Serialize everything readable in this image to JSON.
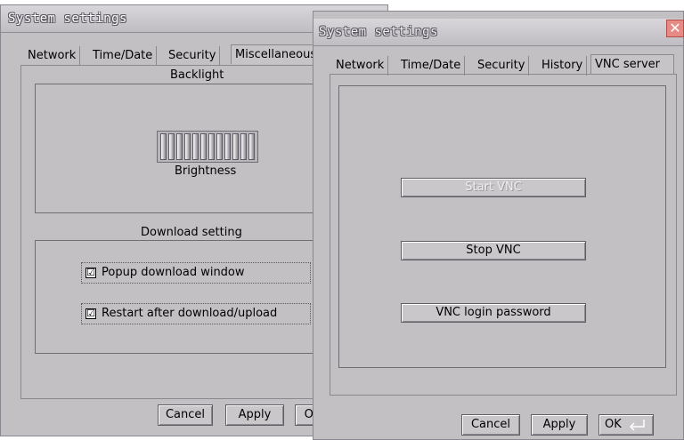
{
  "back_window": {
    "title": "System settings",
    "tabs": [
      "Network",
      "Time/Date",
      "Security",
      "Miscellaneous"
    ],
    "backlight": {
      "heading": "Backlight",
      "slider_label": "Brightness",
      "slider_segments": 12
    },
    "download": {
      "heading": "Download setting",
      "options": [
        {
          "label": "Popup download window",
          "checked": true,
          "mark": "☑"
        },
        {
          "label": "Restart after download/upload",
          "checked": true,
          "mark": "☑"
        }
      ]
    },
    "buttons": {
      "cancel": "Cancel",
      "apply": "Apply",
      "ok": "OK"
    }
  },
  "front_window": {
    "title": "System settings",
    "close_glyph": "✕",
    "tabs": [
      "Network",
      "Time/Date",
      "Security",
      "History",
      "VNC server"
    ],
    "active_tab": "VNC server",
    "vnc": {
      "start_label": "Start VNC",
      "start_enabled": false,
      "stop_label": "Stop VNC",
      "password_label": "VNC login password"
    },
    "buttons": {
      "cancel": "Cancel",
      "apply": "Apply",
      "ok": "OK"
    },
    "ok_icon": "enter-key-icon"
  },
  "colors": {
    "window_bg": "#c3c0c4",
    "close_button": "#e58a85",
    "text": "#000000"
  }
}
